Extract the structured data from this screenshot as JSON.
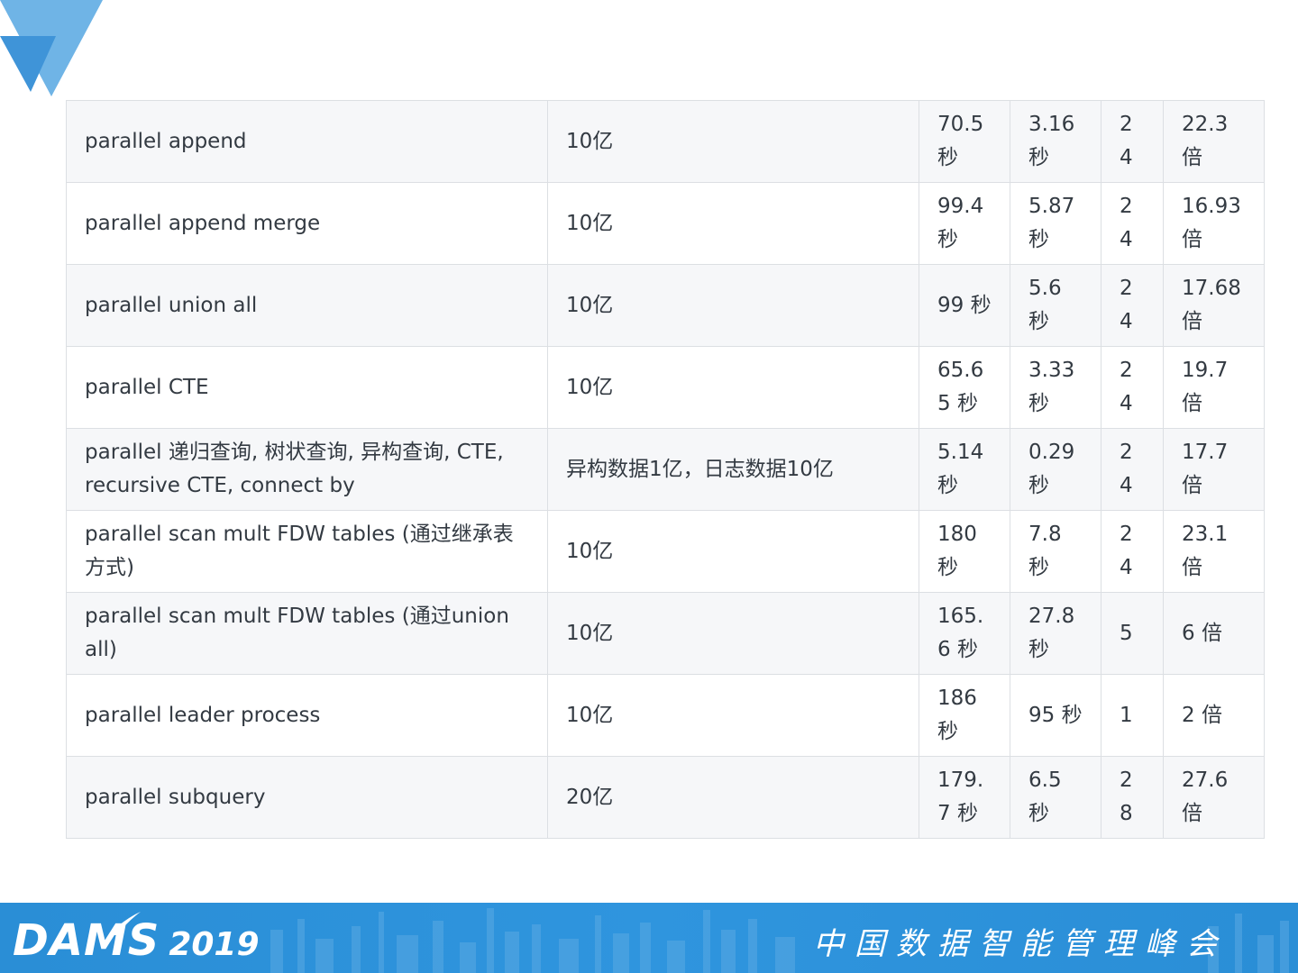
{
  "table": {
    "rows": [
      [
        "parallel append",
        "10亿",
        "70.5 秒",
        "3.16 秒",
        "24",
        "22.3 倍"
      ],
      [
        "parallel append merge",
        "10亿",
        "99.4 秒",
        "5.87 秒",
        "24",
        "16.93 倍"
      ],
      [
        "parallel union all",
        "10亿",
        "99 秒",
        "5.6 秒",
        "24",
        "17.68 倍"
      ],
      [
        "parallel CTE",
        "10亿",
        "65.65 秒",
        "3.33 秒",
        "24",
        "19.7 倍"
      ],
      [
        "parallel 递归查询, 树状查询, 异构查询, CTE, recursive CTE, connect by",
        "异构数据1亿，日志数据10亿",
        "5.14 秒",
        "0.29 秒",
        "24",
        "17.7 倍"
      ],
      [
        "parallel scan mult FDW tables (通过继承表方式)",
        "10亿",
        "180 秒",
        "7.8 秒",
        "24",
        "23.1 倍"
      ],
      [
        "parallel scan mult FDW tables (通过union all)",
        "10亿",
        "165.6 秒",
        "27.8 秒",
        "5",
        "6 倍"
      ],
      [
        "parallel leader process",
        "10亿",
        "186 秒",
        "95 秒",
        "1",
        "2 倍"
      ],
      [
        "parallel subquery",
        "20亿",
        "179.7 秒",
        "6.5 秒",
        "28",
        "27.6 倍"
      ]
    ]
  },
  "footer": {
    "brand_name": "DAMS",
    "brand_year": "2019",
    "summit_title": "中国数据智能管理峰会"
  },
  "colors": {
    "footer_blue": "#2f95de",
    "logo_blue_light": "#6fb4e6",
    "logo_blue_dark": "#3f94d8",
    "row_stripe": "#f6f7f9",
    "border": "#dcdfe3",
    "text": "#333a42"
  },
  "icons": {
    "corner_logo": "blue-triangle-logo",
    "brand_swoosh": "spark-swoosh-icon"
  }
}
